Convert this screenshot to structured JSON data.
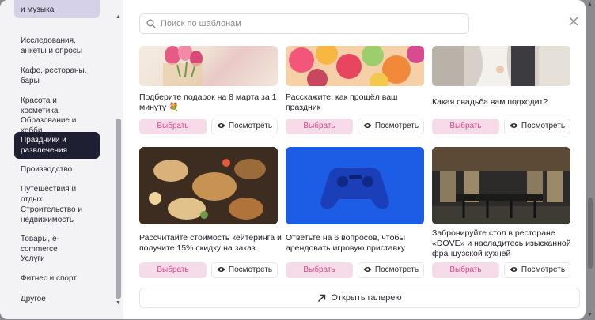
{
  "sidebar": {
    "items": [
      {
        "label": "и музыка",
        "state": "cut"
      },
      {
        "label": "Исследования, анкеты и опросы"
      },
      {
        "label": "Кафе, рестораны, бары"
      },
      {
        "label": "Красота и косметика"
      },
      {
        "label": "Образование и хобби"
      },
      {
        "label": "Праздники и развлечения",
        "state": "active"
      },
      {
        "label": "Производство"
      },
      {
        "label": "Путешествия и отдых"
      },
      {
        "label": "Строительство и недвижимость"
      },
      {
        "label": "Товары, e-commerce"
      },
      {
        "label": "Услуги"
      },
      {
        "label": "Фитнес и спорт"
      },
      {
        "label": "Другое"
      }
    ]
  },
  "search": {
    "placeholder": "Поиск по шаблонам",
    "value": ""
  },
  "cards": [
    {
      "title": "Подберите подарок на 8 марта за 1 минуту 💐",
      "image": "tulips-gift"
    },
    {
      "title": "Расскажите, как прошёл ваш праздник",
      "image": "balloons"
    },
    {
      "title": "Какая свадьба вам подходит?",
      "image": "wedding"
    },
    {
      "title": "Рассчитайте стоимость кейтеринга и получите 15% скидку на заказ",
      "image": "catering-table"
    },
    {
      "title": "Ответьте на 6 вопросов, чтобы арендовать игровую приставку",
      "image": "gamepad"
    },
    {
      "title": "Забронируйте стол в ресторане «DOVE» и насладитесь изысканной французской кухней",
      "image": "restaurant-interior"
    }
  ],
  "buttons": {
    "choose": "Выбрать",
    "view": "Посмотреть"
  },
  "gallery": {
    "label": "Открыть галерею"
  },
  "colors": {
    "accent": "#d24a8e",
    "accent_bg": "#f6dbe9",
    "active_nav": "#1f1f33"
  }
}
